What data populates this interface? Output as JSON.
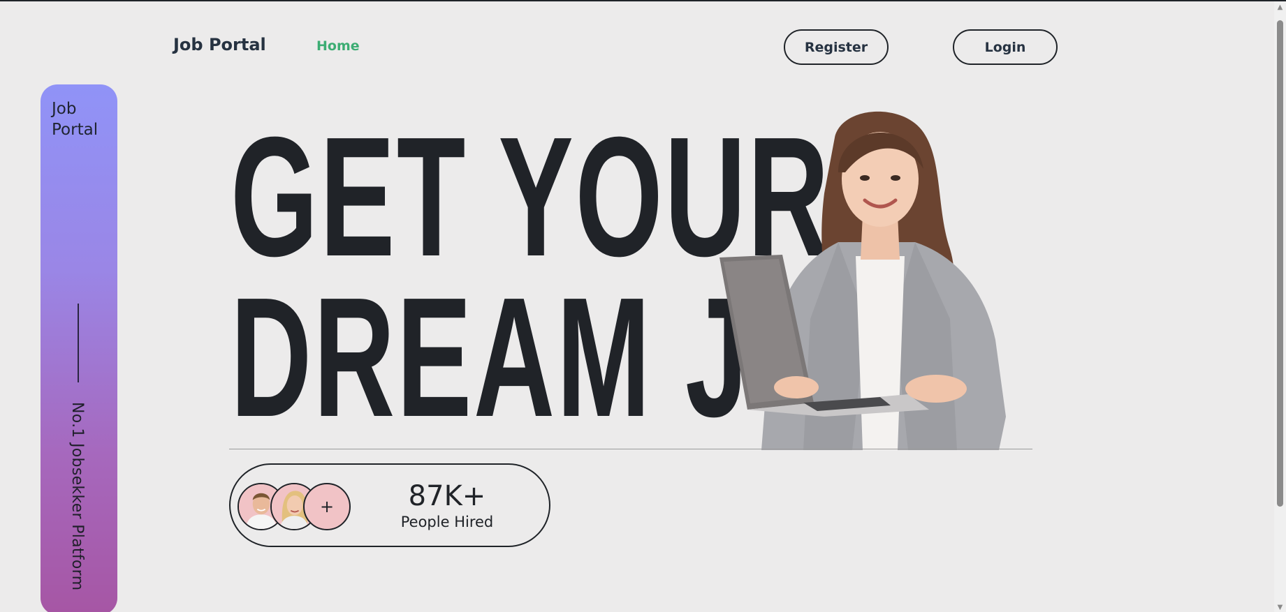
{
  "nav": {
    "brand": "Job Portal",
    "home": "Home",
    "register": "Register",
    "login": "Login"
  },
  "side_card": {
    "title": "Job Portal",
    "tagline": "No.1 Jobsekker Platform"
  },
  "hero": {
    "line1": "GET YOUR",
    "line2": "DREAM JOB"
  },
  "stats": {
    "plus": "+",
    "value": "87K+",
    "label": "People Hired"
  },
  "colors": {
    "accent_green": "#3cad73",
    "text_dark": "#202328",
    "page_bg": "#ecebeb",
    "gradient_top": "#9093f7",
    "gradient_bottom": "#a656a4"
  }
}
